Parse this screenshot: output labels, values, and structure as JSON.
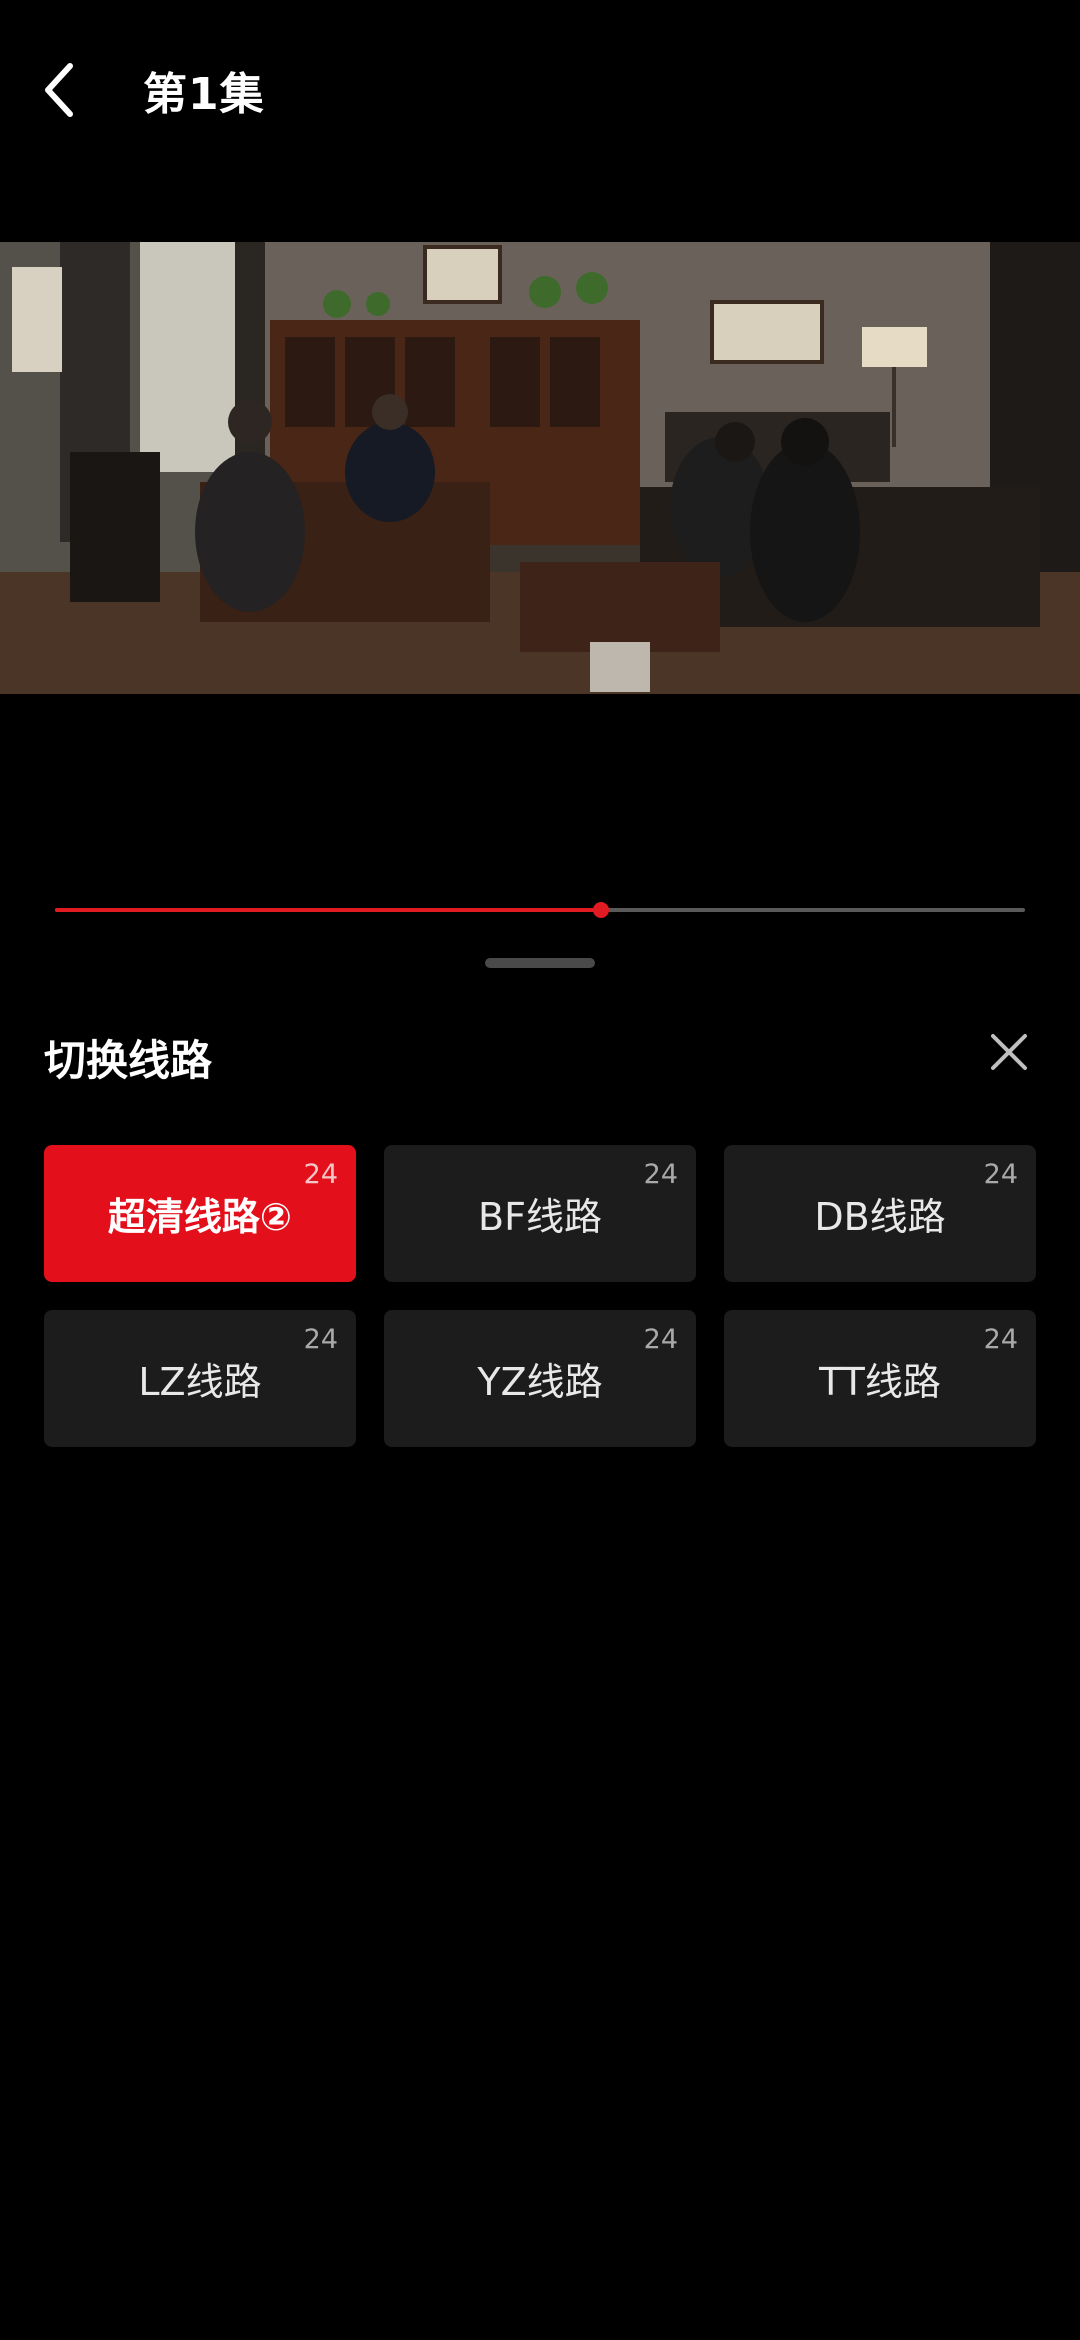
{
  "header": {
    "title": "第1集",
    "back_icon": "chevron-left-icon"
  },
  "player": {
    "progress_fraction": 0.563,
    "progress_color": "#e01b22"
  },
  "route_sheet": {
    "title": "切换线路",
    "close_icon": "close-icon",
    "routes": [
      {
        "label": "超清线路②",
        "count": "24",
        "active": true
      },
      {
        "label": "BF线路",
        "count": "24",
        "active": false
      },
      {
        "label": "DB线路",
        "count": "24",
        "active": false
      },
      {
        "label": "LZ线路",
        "count": "24",
        "active": false
      },
      {
        "label": "YZ线路",
        "count": "24",
        "active": false
      },
      {
        "label": "TT线路",
        "count": "24",
        "active": false
      }
    ],
    "accent_color": "#e3101b"
  }
}
